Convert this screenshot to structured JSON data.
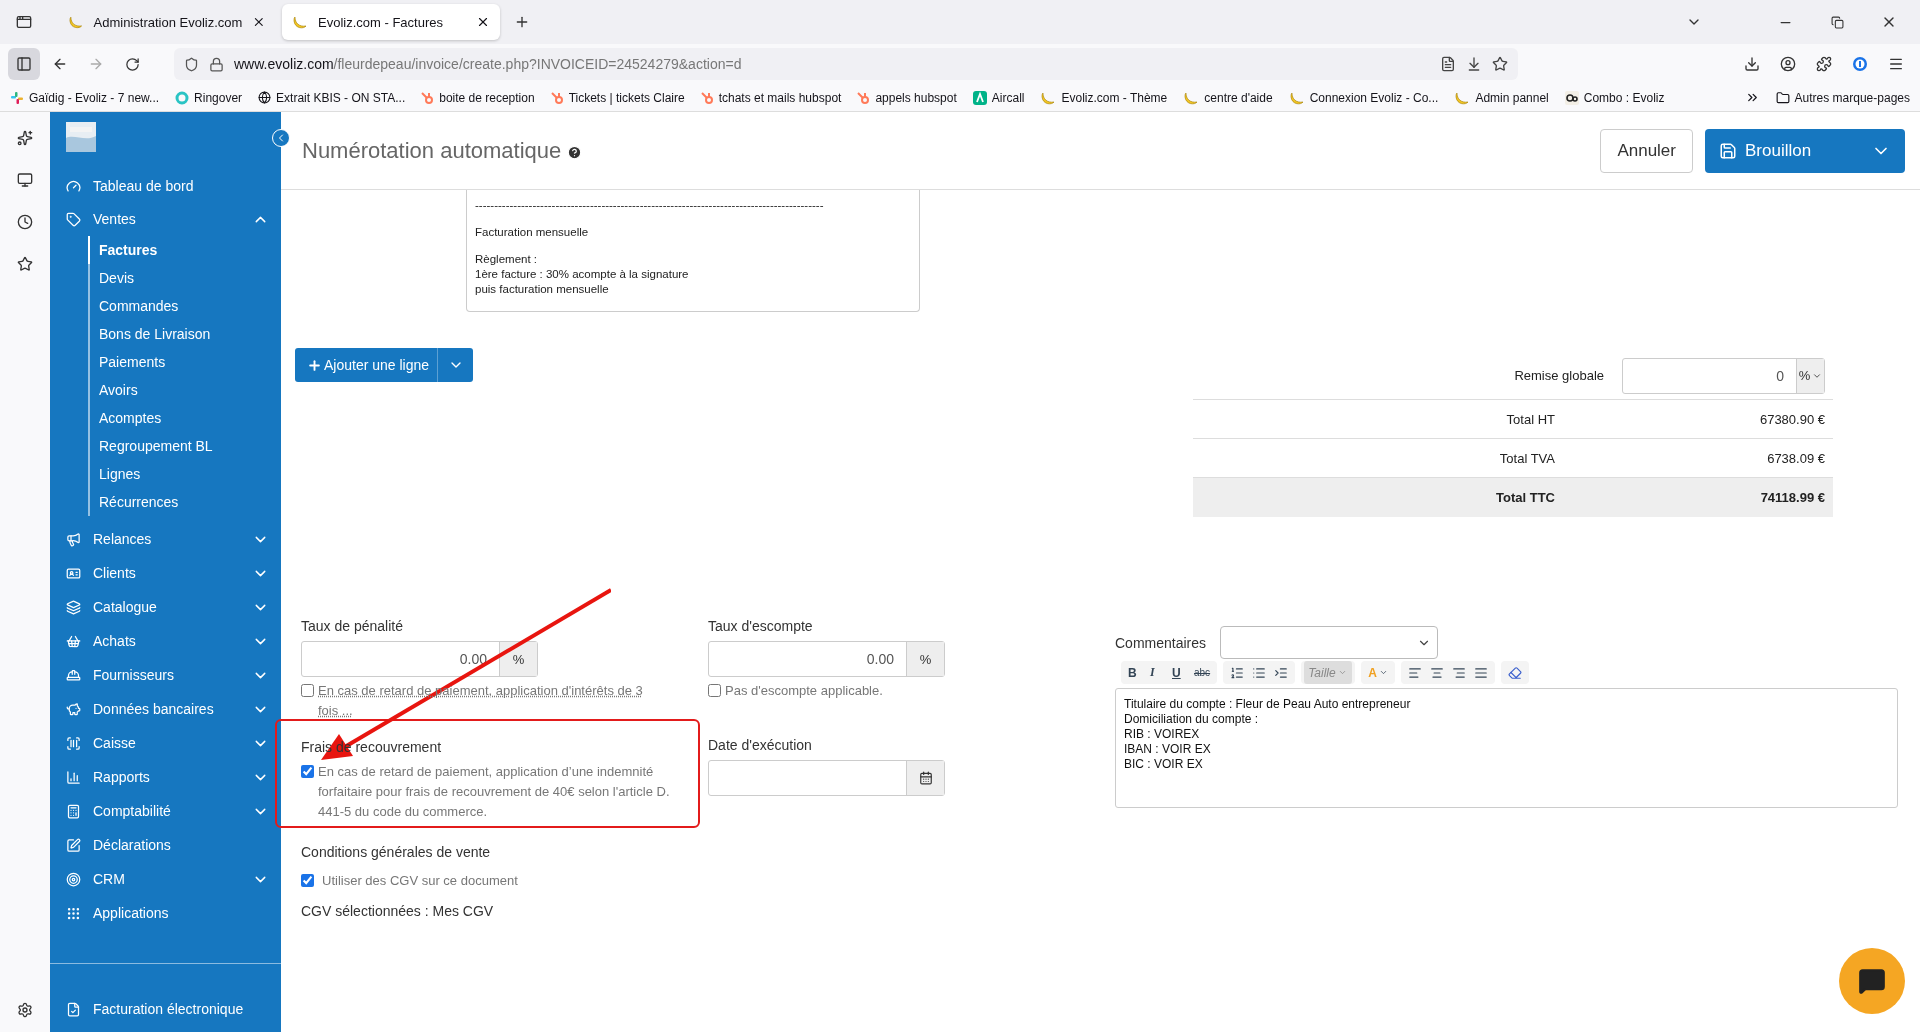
{
  "browser": {
    "tabs": [
      {
        "title": "Administration Evoliz.com",
        "selected": false
      },
      {
        "title": "Evoliz.com - Factures",
        "selected": true
      }
    ],
    "url": {
      "host": "www.evoliz.com",
      "path": "/fleurdepeau/invoice/create.php?INVOICEID=24524279&action=d"
    },
    "bookmarks": [
      {
        "kind": "slack",
        "label": "Gaïdig - Evoliz - 7 new..."
      },
      {
        "kind": "ring",
        "label": "Ringover"
      },
      {
        "kind": "globe",
        "label": "Extrait KBIS - ON STA..."
      },
      {
        "kind": "hubspot",
        "label": "boite de reception"
      },
      {
        "kind": "hubspot",
        "label": "Tickets | tickets Claire"
      },
      {
        "kind": "hubspot",
        "label": "tchats et mails hubspot"
      },
      {
        "kind": "hubspot",
        "label": "appels hubspot"
      },
      {
        "kind": "aircall",
        "label": "Aircall"
      },
      {
        "kind": "banana",
        "label": "Evoliz.com - Thème"
      },
      {
        "kind": "banana",
        "label": "centre d'aide"
      },
      {
        "kind": "banana",
        "label": "Connexion Evoliz - Co..."
      },
      {
        "kind": "banana",
        "label": "Admin pannel"
      },
      {
        "kind": "combo",
        "label": "Combo : Evoliz"
      }
    ],
    "other_bookmarks": "Autres marque-pages"
  },
  "sidebar": {
    "items": [
      {
        "kind": "link",
        "label": "Tableau de bord"
      },
      {
        "kind": "group",
        "label": "Ventes",
        "expanded": true,
        "children": [
          {
            "label": "Factures",
            "selected": true
          },
          {
            "label": "Devis",
            "selected": false
          },
          {
            "label": "Commandes",
            "selected": false
          },
          {
            "label": "Bons de Livraison",
            "selected": false
          },
          {
            "label": "Paiements",
            "selected": false
          },
          {
            "label": "Avoirs",
            "selected": false
          },
          {
            "label": "Acomptes",
            "selected": false
          },
          {
            "label": "Regroupement BL",
            "selected": false
          },
          {
            "label": "Lignes",
            "selected": false
          },
          {
            "label": "Récurrences",
            "selected": false
          }
        ]
      },
      {
        "kind": "group",
        "label": "Relances",
        "expanded": false
      },
      {
        "kind": "group",
        "label": "Clients",
        "expanded": false
      },
      {
        "kind": "group",
        "label": "Catalogue",
        "expanded": false
      },
      {
        "kind": "group",
        "label": "Achats",
        "expanded": false
      },
      {
        "kind": "group",
        "label": "Fournisseurs",
        "expanded": false
      },
      {
        "kind": "group",
        "label": "Données bancaires",
        "expanded": false
      },
      {
        "kind": "group",
        "label": "Caisse",
        "expanded": false
      },
      {
        "kind": "group",
        "label": "Rapports",
        "expanded": false
      },
      {
        "kind": "group",
        "label": "Comptabilité",
        "expanded": false
      },
      {
        "kind": "link",
        "label": "Déclarations"
      },
      {
        "kind": "group",
        "label": "CRM",
        "expanded": false
      },
      {
        "kind": "link",
        "label": "Applications"
      }
    ],
    "footer_item": "Facturation électronique"
  },
  "header": {
    "title": "Numérotation automatique",
    "cancel": "Annuler",
    "save": "Brouillon"
  },
  "notes": {
    "paragraphs": [
      [
        "-------------------------------------------------------------------------------------------"
      ],
      [
        "Facturation mensuelle"
      ],
      [
        "Règlement :",
        "1ère facture : 30% acompte à la signature",
        "puis facturation mensuelle"
      ]
    ]
  },
  "add_line": "Ajouter une ligne",
  "totals": {
    "discount": {
      "label": "Remise globale",
      "value": "0",
      "unit": "%"
    },
    "rows": [
      {
        "label": "Total HT",
        "value": "67380.90 €",
        "highlighted": false
      },
      {
        "label": "Total TVA",
        "value": "6738.09 €",
        "highlighted": false
      },
      {
        "label": "Total TTC",
        "value": "74118.99 €",
        "highlighted": true
      }
    ]
  },
  "penalty": {
    "label": "Taux de pénalité",
    "value": "0.00",
    "unit": "%",
    "checked": false,
    "text": "En cas de retard de paiement, application d'intérêts de 3 fois ..."
  },
  "discount_rate": {
    "label": "Taux d'escompte",
    "value": "0.00",
    "unit": "%",
    "checked": false,
    "text": "Pas d'escompte applicable."
  },
  "recovery": {
    "label": "Frais de recouvrement",
    "checked": true,
    "text": "En cas de retard de paiement, application d’une indemnité forfaitaire pour frais de recouvrement de 40€ selon l'article D. 441-5 du code du commerce."
  },
  "execution_date": {
    "label": "Date d'exécution"
  },
  "cgv": {
    "label": "Conditions générales de vente",
    "checked": true,
    "text": "Utiliser des CGV sur ce document",
    "selection": "CGV sélectionnées : Mes CGV"
  },
  "comments": {
    "label": "Commentaires",
    "toolbar": [
      [
        {
          "kind": "bold",
          "label": "B"
        },
        {
          "kind": "italic",
          "label": "I"
        },
        {
          "kind": "underline",
          "label": "U"
        },
        {
          "kind": "strike",
          "label": "abc"
        }
      ],
      [
        {
          "kind": "ol"
        },
        {
          "kind": "ul"
        },
        {
          "kind": "indent"
        }
      ],
      [
        {
          "kind": "dropdown",
          "label": "Taille"
        }
      ],
      [
        {
          "kind": "color",
          "label": "A"
        }
      ],
      [
        {
          "kind": "align-left"
        },
        {
          "kind": "align-center"
        },
        {
          "kind": "align-right"
        },
        {
          "kind": "justify"
        }
      ],
      [
        {
          "kind": "eraser"
        }
      ]
    ],
    "lines": [
      "Titulaire du compte : Fleur de Peau Auto entrepreneur",
      "Domiciliation du compte :",
      "RIB : VOIREX",
      "IBAN : VOIR EX",
      "BIC : VOIR EX"
    ]
  }
}
